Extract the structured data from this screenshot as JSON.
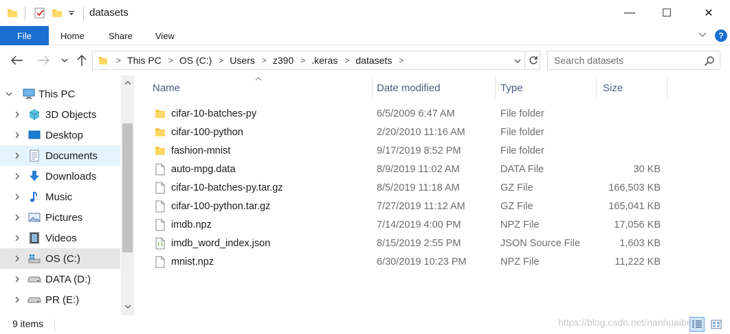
{
  "window": {
    "title": "datasets",
    "minimize_glyph": "—",
    "maximize_glyph": "☐",
    "close_glyph": "✕"
  },
  "ribbon": {
    "tabs": {
      "file": "File",
      "home": "Home",
      "share": "Share",
      "view": "View"
    },
    "help_glyph": "?"
  },
  "address": {
    "breadcrumbs": [
      "This PC",
      "OS (C:)",
      "Users",
      "z390",
      ".keras",
      "datasets"
    ],
    "separator": ">"
  },
  "search": {
    "placeholder": "Search datasets"
  },
  "sidebar": {
    "items": [
      {
        "label": "This PC",
        "icon": "this-pc-icon",
        "expanded": true
      },
      {
        "label": "3D Objects",
        "icon": "3d-objects-icon"
      },
      {
        "label": "Desktop",
        "icon": "desktop-icon"
      },
      {
        "label": "Documents",
        "icon": "documents-icon",
        "state": "hover"
      },
      {
        "label": "Downloads",
        "icon": "downloads-icon"
      },
      {
        "label": "Music",
        "icon": "music-icon"
      },
      {
        "label": "Pictures",
        "icon": "pictures-icon"
      },
      {
        "label": "Videos",
        "icon": "videos-icon"
      },
      {
        "label": "OS (C:)",
        "icon": "windows-drive-icon",
        "state": "selected"
      },
      {
        "label": "DATA (D:)",
        "icon": "drive-icon"
      },
      {
        "label": "PR (E:)",
        "icon": "drive-icon"
      }
    ]
  },
  "columns": {
    "name": "Name",
    "date": "Date modified",
    "type": "Type",
    "size": "Size"
  },
  "files": [
    {
      "name": "cifar-10-batches-py",
      "date": "6/5/2009 6:47 AM",
      "type": "File folder",
      "size": "",
      "icon": "folder-icon"
    },
    {
      "name": "cifar-100-python",
      "date": "2/20/2010 11:16 AM",
      "type": "File folder",
      "size": "",
      "icon": "folder-icon"
    },
    {
      "name": "fashion-mnist",
      "date": "9/17/2019 8:52 PM",
      "type": "File folder",
      "size": "",
      "icon": "folder-icon"
    },
    {
      "name": "auto-mpg.data",
      "date": "8/9/2019 11:02 AM",
      "type": "DATA File",
      "size": "30 KB",
      "icon": "file-icon"
    },
    {
      "name": "cifar-10-batches-py.tar.gz",
      "date": "8/5/2019 11:18 AM",
      "type": "GZ File",
      "size": "166,503 KB",
      "icon": "file-icon"
    },
    {
      "name": "cifar-100-python.tar.gz",
      "date": "7/27/2019 11:12 AM",
      "type": "GZ File",
      "size": "165,041 KB",
      "icon": "file-icon"
    },
    {
      "name": "imdb.npz",
      "date": "7/14/2019 4:00 PM",
      "type": "NPZ File",
      "size": "17,056 KB",
      "icon": "file-icon"
    },
    {
      "name": "imdb_word_index.json",
      "date": "8/15/2019 2:55 PM",
      "type": "JSON Source File",
      "size": "1,603 KB",
      "icon": "json-file-icon"
    },
    {
      "name": "mnist.npz",
      "date": "6/30/2019 10:23 PM",
      "type": "NPZ File",
      "size": "11,222 KB",
      "icon": "file-icon"
    }
  ],
  "status": {
    "item_count": "9 items",
    "watermark": "https://blog.csdn.net/nanhuaibeian"
  },
  "colors": {
    "accent": "#1a6fd1",
    "folder": "#f6c342",
    "selected_bg": "#e5e5e5",
    "hover_bg": "#e5f3ff",
    "header_text": "#4a5d7e",
    "secondary_text": "#6d6d6d"
  }
}
